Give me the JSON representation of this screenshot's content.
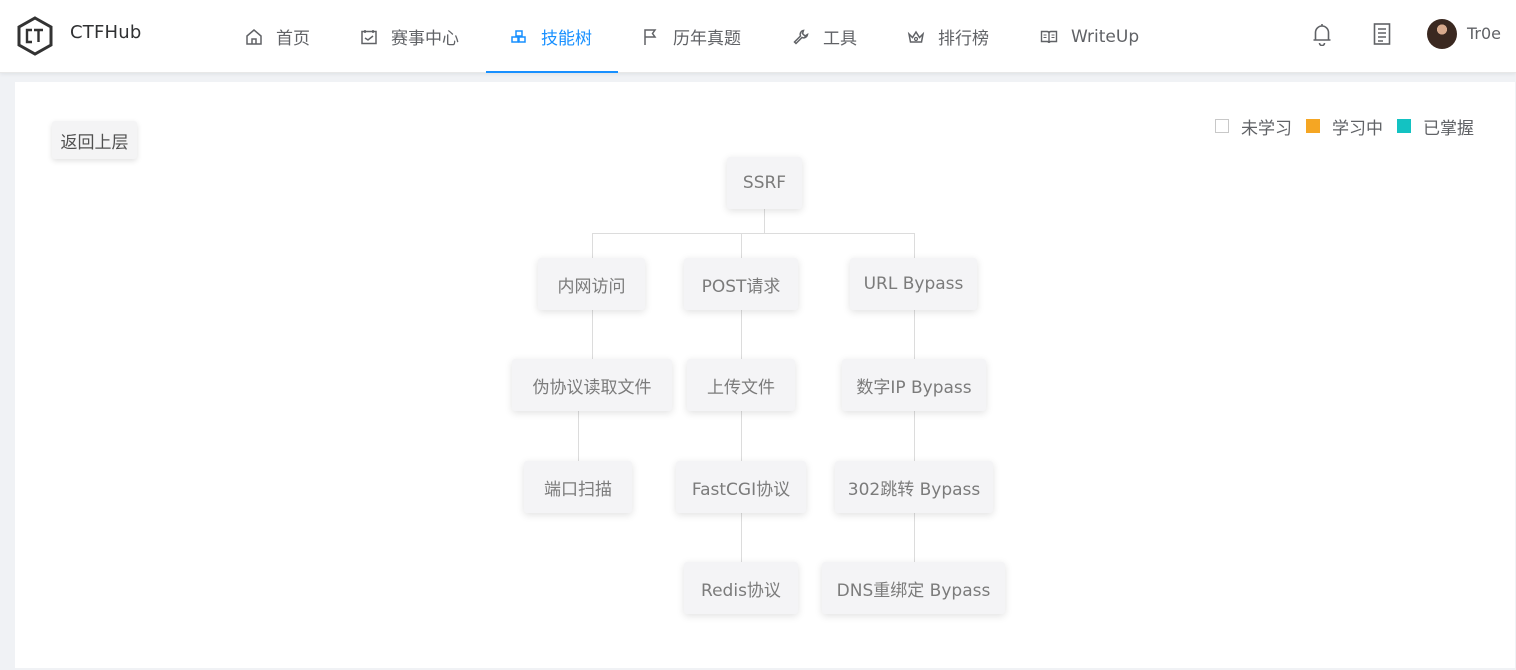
{
  "brand": {
    "name": "CTFHub",
    "logo": "ctfhub-logo"
  },
  "nav": {
    "items": [
      {
        "label": "首页",
        "icon": "home-icon"
      },
      {
        "label": "赛事中心",
        "icon": "calendar-icon"
      },
      {
        "label": "技能树",
        "icon": "skill-tree-icon",
        "active": true
      },
      {
        "label": "历年真题",
        "icon": "flag-icon"
      },
      {
        "label": "工具",
        "icon": "wrench-icon"
      },
      {
        "label": "排行榜",
        "icon": "crown-icon"
      },
      {
        "label": "WriteUp",
        "icon": "book-icon"
      }
    ],
    "active_color": "#1890ff"
  },
  "user": {
    "name": "Tr0e",
    "bell_icon": "bell-icon",
    "doc_icon": "document-icon"
  },
  "back_button": {
    "label": "返回上层"
  },
  "legend": {
    "items": [
      {
        "label": "未学习",
        "color": "#ffffff"
      },
      {
        "label": "学习中",
        "color": "#f5a623"
      },
      {
        "label": "已掌握",
        "color": "#13c2c2"
      }
    ]
  },
  "tree": {
    "root": "SSRF",
    "level1": [
      "内网访问",
      "POST请求",
      "URL Bypass"
    ],
    "level2": [
      "伪协议读取文件",
      "上传文件",
      "数字IP Bypass"
    ],
    "level3": [
      "端口扫描",
      "FastCGI协议",
      "302跳转 Bypass"
    ],
    "level4": [
      "Redis协议",
      "DNS重绑定 Bypass"
    ]
  }
}
